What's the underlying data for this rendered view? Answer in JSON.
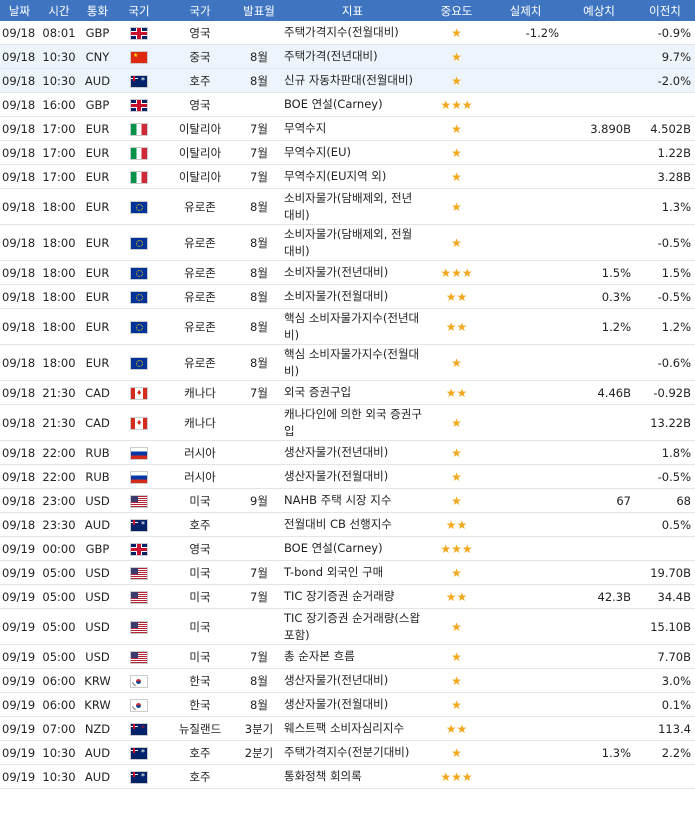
{
  "header": {
    "date": "날짜",
    "time": "시간",
    "currency": "통화",
    "flag": "국기",
    "country": "국가",
    "period": "발표월",
    "indicator": "지표",
    "importance": "중요도",
    "actual": "실제치",
    "forecast": "예상치",
    "previous": "이전치"
  },
  "colors": {
    "header_bg": "#3f75c0",
    "star": "#f2a81d",
    "row_highlight": "#eef4fb"
  },
  "rows": [
    {
      "date": "09/18",
      "time": "08:01",
      "currency": "GBP",
      "flag": "gb",
      "country": "영국",
      "period": "",
      "indicator": "주택가격지수(전월대비)",
      "importance": "★",
      "actual": "-1.2%",
      "forecast": "",
      "previous": "-0.9%"
    },
    {
      "date": "09/18",
      "time": "10:30",
      "currency": "CNY",
      "flag": "cn",
      "country": "중국",
      "period": "8월",
      "indicator": "주택가격(전년대비)",
      "importance": "★",
      "actual": "",
      "forecast": "",
      "previous": "9.7%"
    },
    {
      "date": "09/18",
      "time": "10:30",
      "currency": "AUD",
      "flag": "au",
      "country": "호주",
      "period": "8월",
      "indicator": "신규 자동차판대(전월대비)",
      "importance": "★",
      "actual": "",
      "forecast": "",
      "previous": "-2.0%"
    },
    {
      "date": "09/18",
      "time": "16:00",
      "currency": "GBP",
      "flag": "gb",
      "country": "영국",
      "period": "",
      "indicator": "BOE 연설(Carney)",
      "importance": "★★★",
      "actual": "",
      "forecast": "",
      "previous": ""
    },
    {
      "date": "09/18",
      "time": "17:00",
      "currency": "EUR",
      "flag": "it",
      "country": "이탈리아",
      "period": "7월",
      "indicator": "무역수지",
      "importance": "★",
      "actual": "",
      "forecast": "3.890B",
      "previous": "4.502B"
    },
    {
      "date": "09/18",
      "time": "17:00",
      "currency": "EUR",
      "flag": "it",
      "country": "이탈리아",
      "period": "7월",
      "indicator": "무역수지(EU)",
      "importance": "★",
      "actual": "",
      "forecast": "",
      "previous": "1.22B"
    },
    {
      "date": "09/18",
      "time": "17:00",
      "currency": "EUR",
      "flag": "it",
      "country": "이탈리아",
      "period": "7월",
      "indicator": "무역수지(EU지역 외)",
      "importance": "★",
      "actual": "",
      "forecast": "",
      "previous": "3.28B"
    },
    {
      "date": "09/18",
      "time": "18:00",
      "currency": "EUR",
      "flag": "eu",
      "country": "유로존",
      "period": "8월",
      "indicator": "소비자물가(담배제외, 전년대비)",
      "importance": "★",
      "actual": "",
      "forecast": "",
      "previous": "1.3%"
    },
    {
      "date": "09/18",
      "time": "18:00",
      "currency": "EUR",
      "flag": "eu",
      "country": "유로존",
      "period": "8월",
      "indicator": "소비자물가(담배제외, 전월대비)",
      "importance": "★",
      "actual": "",
      "forecast": "",
      "previous": "-0.5%"
    },
    {
      "date": "09/18",
      "time": "18:00",
      "currency": "EUR",
      "flag": "eu",
      "country": "유로존",
      "period": "8월",
      "indicator": "소비자물가(전년대비)",
      "importance": "★★★",
      "actual": "",
      "forecast": "1.5%",
      "previous": "1.5%"
    },
    {
      "date": "09/18",
      "time": "18:00",
      "currency": "EUR",
      "flag": "eu",
      "country": "유로존",
      "period": "8월",
      "indicator": "소비자물가(전월대비)",
      "importance": "★★",
      "actual": "",
      "forecast": "0.3%",
      "previous": "-0.5%"
    },
    {
      "date": "09/18",
      "time": "18:00",
      "currency": "EUR",
      "flag": "eu",
      "country": "유로존",
      "period": "8월",
      "indicator": "핵심 소비자물가지수(전년대비)",
      "importance": "★★",
      "actual": "",
      "forecast": "1.2%",
      "previous": "1.2%"
    },
    {
      "date": "09/18",
      "time": "18:00",
      "currency": "EUR",
      "flag": "eu",
      "country": "유로존",
      "period": "8월",
      "indicator": "핵심 소비자물가지수(전월대비)",
      "importance": "★",
      "actual": "",
      "forecast": "",
      "previous": "-0.6%"
    },
    {
      "date": "09/18",
      "time": "21:30",
      "currency": "CAD",
      "flag": "ca",
      "country": "캐나다",
      "period": "7월",
      "indicator": "외국 증권구입",
      "importance": "★★",
      "actual": "",
      "forecast": "4.46B",
      "previous": "-0.92B"
    },
    {
      "date": "09/18",
      "time": "21:30",
      "currency": "CAD",
      "flag": "ca",
      "country": "캐나다",
      "period": "",
      "indicator": "캐나다인에 의한 외국 증권구입",
      "importance": "★",
      "actual": "",
      "forecast": "",
      "previous": "13.22B"
    },
    {
      "date": "09/18",
      "time": "22:00",
      "currency": "RUB",
      "flag": "ru",
      "country": "러시아",
      "period": "",
      "indicator": "생산자물가(전년대비)",
      "importance": "★",
      "actual": "",
      "forecast": "",
      "previous": "1.8%"
    },
    {
      "date": "09/18",
      "time": "22:00",
      "currency": "RUB",
      "flag": "ru",
      "country": "러시아",
      "period": "",
      "indicator": "생산자물가(전월대비)",
      "importance": "★",
      "actual": "",
      "forecast": "",
      "previous": "-0.5%"
    },
    {
      "date": "09/18",
      "time": "23:00",
      "currency": "USD",
      "flag": "us",
      "country": "미국",
      "period": "9월",
      "indicator": "NAHB 주택 시장 지수",
      "importance": "★",
      "actual": "",
      "forecast": "67",
      "previous": "68"
    },
    {
      "date": "09/18",
      "time": "23:30",
      "currency": "AUD",
      "flag": "au",
      "country": "호주",
      "period": "",
      "indicator": "전월대비 CB 선행지수",
      "importance": "★★",
      "actual": "",
      "forecast": "",
      "previous": "0.5%"
    },
    {
      "date": "09/19",
      "time": "00:00",
      "currency": "GBP",
      "flag": "gb",
      "country": "영국",
      "period": "",
      "indicator": "BOE 연설(Carney)",
      "importance": "★★★",
      "actual": "",
      "forecast": "",
      "previous": ""
    },
    {
      "date": "09/19",
      "time": "05:00",
      "currency": "USD",
      "flag": "us",
      "country": "미국",
      "period": "7월",
      "indicator": "T-bond 외국인 구매",
      "importance": "★",
      "actual": "",
      "forecast": "",
      "previous": "19.70B"
    },
    {
      "date": "09/19",
      "time": "05:00",
      "currency": "USD",
      "flag": "us",
      "country": "미국",
      "period": "7월",
      "indicator": "TIC 장기증권 순거래량",
      "importance": "★★",
      "actual": "",
      "forecast": "42.3B",
      "previous": "34.4B"
    },
    {
      "date": "09/19",
      "time": "05:00",
      "currency": "USD",
      "flag": "us",
      "country": "미국",
      "period": "",
      "indicator": "TIC 장기증권 순거래량(스왑 포함)",
      "importance": "★",
      "actual": "",
      "forecast": "",
      "previous": "15.10B"
    },
    {
      "date": "09/19",
      "time": "05:00",
      "currency": "USD",
      "flag": "us",
      "country": "미국",
      "period": "7월",
      "indicator": "총 순자본 흐름",
      "importance": "★",
      "actual": "",
      "forecast": "",
      "previous": "7.70B"
    },
    {
      "date": "09/19",
      "time": "06:00",
      "currency": "KRW",
      "flag": "kr",
      "country": "한국",
      "period": "8월",
      "indicator": "생산자물가(전년대비)",
      "importance": "★",
      "actual": "",
      "forecast": "",
      "previous": "3.0%"
    },
    {
      "date": "09/19",
      "time": "06:00",
      "currency": "KRW",
      "flag": "kr",
      "country": "한국",
      "period": "8월",
      "indicator": "생산자물가(전월대비)",
      "importance": "★",
      "actual": "",
      "forecast": "",
      "previous": "0.1%"
    },
    {
      "date": "09/19",
      "time": "07:00",
      "currency": "NZD",
      "flag": "nz",
      "country": "뉴질랜드",
      "period": "3분기",
      "indicator": "웨스트팩 소비자심리지수",
      "importance": "★★",
      "actual": "",
      "forecast": "",
      "previous": "113.4"
    },
    {
      "date": "09/19",
      "time": "10:30",
      "currency": "AUD",
      "flag": "au",
      "country": "호주",
      "period": "2분기",
      "indicator": "주택가격지수(전분기대비)",
      "importance": "★",
      "actual": "",
      "forecast": "1.3%",
      "previous": "2.2%"
    },
    {
      "date": "09/19",
      "time": "10:30",
      "currency": "AUD",
      "flag": "au",
      "country": "호주",
      "period": "",
      "indicator": "통화정책 회의록",
      "importance": "★★★",
      "actual": "",
      "forecast": "",
      "previous": ""
    }
  ]
}
